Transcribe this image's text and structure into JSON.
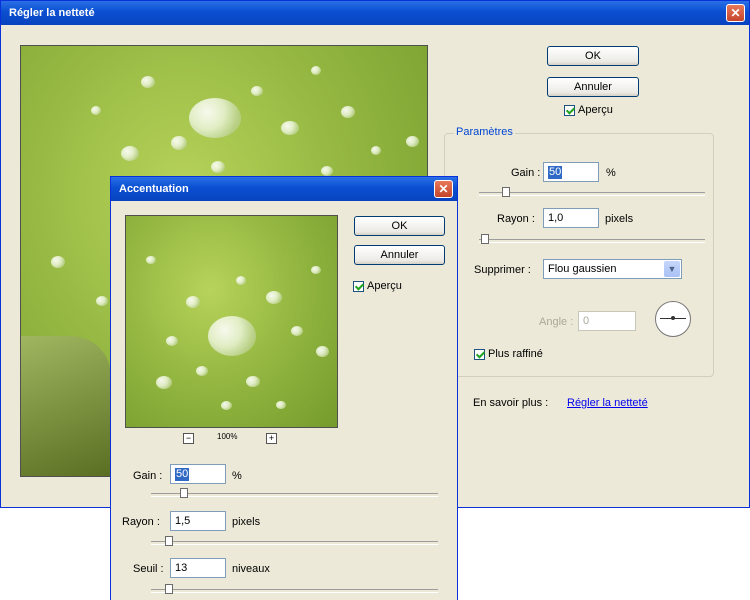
{
  "back_dialog": {
    "title": "Régler la netteté",
    "ok_label": "OK",
    "cancel_label": "Annuler",
    "preview_label": "Aperçu",
    "params_legend": "Paramètres",
    "gain_label": "Gain :",
    "gain_value": "50",
    "gain_unit": "%",
    "gain_level": 0.1,
    "radius_label": "Rayon :",
    "radius_value": "1,0",
    "radius_unit": "pixels",
    "radius_level": 0.01,
    "remove_label": "Supprimer :",
    "remove_value": "Flou gaussien",
    "angle_label": "Angle :",
    "angle_value": "0",
    "more_refined_label": "Plus raffiné",
    "learn_more_label": "En savoir plus :",
    "learn_more_link": "Régler la netteté"
  },
  "front_dialog": {
    "title": "Accentuation",
    "ok_label": "OK",
    "cancel_label": "Annuler",
    "preview_label": "Aperçu",
    "zoom_minus": "−",
    "zoom_level": "100%",
    "zoom_plus": "+",
    "gain_label": "Gain :",
    "gain_value": "50",
    "gain_unit": "%",
    "gain_level": 0.1,
    "radius_label": "Rayon :",
    "radius_value": "1,5",
    "radius_unit": "pixels",
    "radius_level": 0.05,
    "threshold_label": "Seuil :",
    "threshold_value": "13",
    "threshold_unit": "niveaux",
    "threshold_level": 0.05
  },
  "icons": {
    "close": "close-icon",
    "dropdown": "chevron-down-icon",
    "angle": "angle-dial-icon"
  },
  "colors": {
    "titlebar": "#0a4fd0",
    "dialog_bg": "#ece9d8",
    "link": "#0000ee"
  }
}
